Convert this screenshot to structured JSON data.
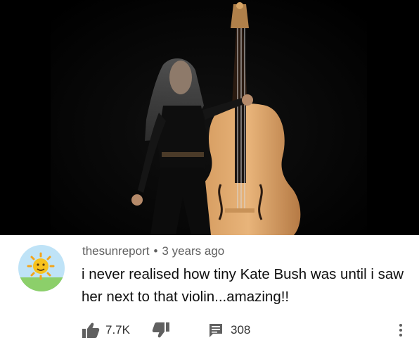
{
  "video": {
    "description_icon": "video-frame"
  },
  "comment": {
    "author": "thesunreport",
    "separator": "•",
    "time_ago": "3 years ago",
    "text": "i never realised how tiny Kate Bush was until i saw her next to that violin...amazing!!",
    "avatar_icon": "sun-avatar-icon"
  },
  "actions": {
    "like_icon": "thumbs-up-icon",
    "like_count": "7.7K",
    "dislike_icon": "thumbs-down-icon",
    "reply_icon": "reply-comment-icon",
    "reply_count": "308",
    "more_icon": "more-vertical-icon"
  },
  "colors": {
    "video_bg": "#060606",
    "meta_text": "#606060",
    "comment_text": "#0f0f0f",
    "icon": "#606060"
  }
}
